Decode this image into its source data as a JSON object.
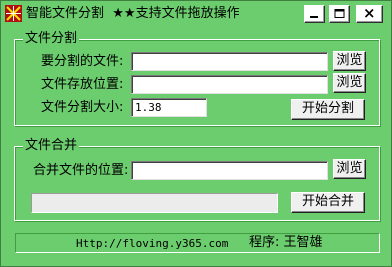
{
  "window": {
    "title": "智能文件分割  ★★支持文件拖放操作",
    "minimize_icon": "minimize-icon",
    "maximize_icon": "maximize-icon",
    "close_icon": "close-icon"
  },
  "split_group": {
    "title": "文件分割",
    "file_label": "要分割的文件:",
    "file_value": "",
    "dest_label": "文件存放位置:",
    "dest_value": "",
    "size_label": "文件分割大小:",
    "size_value": "1.38",
    "browse1": "浏览",
    "browse2": "浏览",
    "start_button": "开始分割"
  },
  "merge_group": {
    "title": "文件合并",
    "location_label": "合并文件的位置:",
    "location_value": "",
    "browse": "浏览",
    "start_button": "开始合并",
    "progress": 0
  },
  "status": {
    "url": "Http://floving.y365.com",
    "author": "程序: 王智雄"
  },
  "colors": {
    "background": "#6ccd6e",
    "button_face": "#f0f0f0",
    "field": "#ffffff"
  }
}
